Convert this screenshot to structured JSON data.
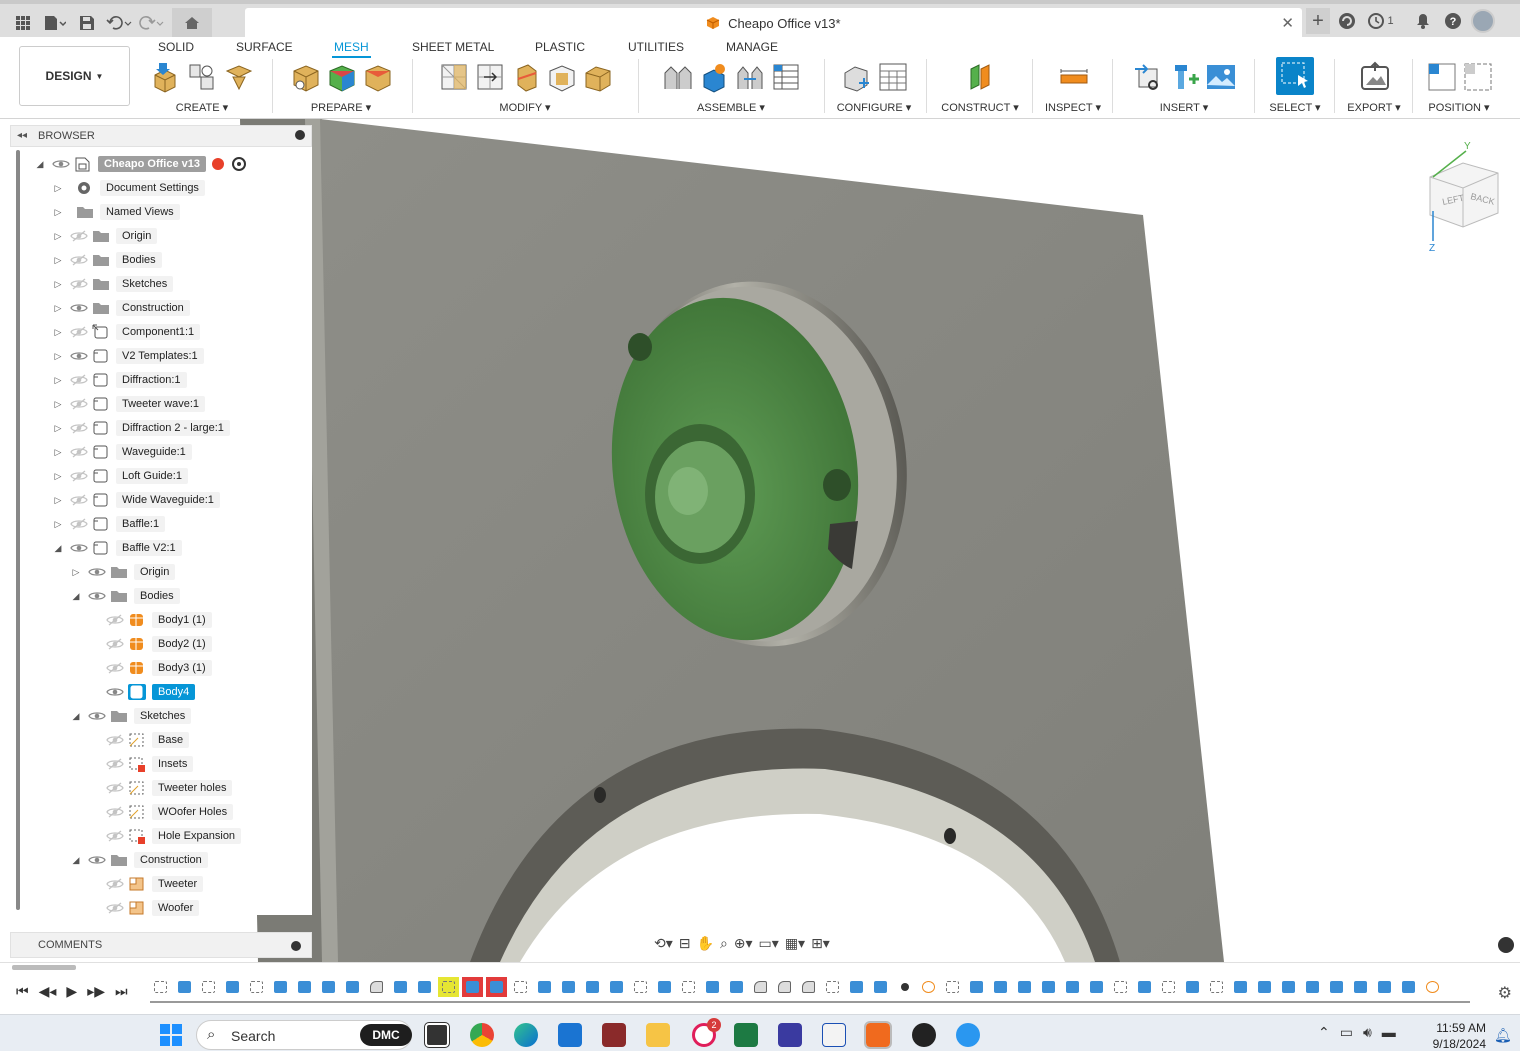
{
  "window": {
    "doc_title": "Cheapo Office v13*",
    "history_count": "1"
  },
  "ribbon": {
    "workspace": "DESIGN",
    "tabs": [
      "SOLID",
      "SURFACE",
      "MESH",
      "SHEET METAL",
      "PLASTIC",
      "UTILITIES",
      "MANAGE"
    ],
    "active_tab": "MESH",
    "groups": [
      "CREATE",
      "PREPARE",
      "MODIFY",
      "ASSEMBLE",
      "CONFIGURE",
      "CONSTRUCT",
      "INSPECT",
      "INSERT",
      "SELECT",
      "EXPORT",
      "POSITION"
    ]
  },
  "browser": {
    "title": "BROWSER",
    "comments": "COMMENTS",
    "items": [
      {
        "label": "Cheapo Office v13",
        "indent": 0,
        "expand": "open",
        "eye": "visible",
        "icon": "document"
      },
      {
        "label": "Document Settings",
        "indent": 1,
        "expand": "closed",
        "eye": "none",
        "icon": "gear"
      },
      {
        "label": "Named Views",
        "indent": 1,
        "expand": "closed",
        "eye": "none",
        "icon": "folder"
      },
      {
        "label": "Origin",
        "indent": 1,
        "expand": "closed",
        "eye": "hidden",
        "icon": "folder"
      },
      {
        "label": "Bodies",
        "indent": 1,
        "expand": "closed",
        "eye": "hidden",
        "icon": "folder"
      },
      {
        "label": "Sketches",
        "indent": 1,
        "expand": "closed",
        "eye": "hidden",
        "icon": "folder"
      },
      {
        "label": "Construction",
        "indent": 1,
        "expand": "closed",
        "eye": "visible",
        "icon": "folder"
      },
      {
        "label": "Component1:1",
        "indent": 1,
        "expand": "closed",
        "eye": "hidden",
        "icon": "component-link"
      },
      {
        "label": "V2 Templates:1",
        "indent": 1,
        "expand": "closed",
        "eye": "visible",
        "icon": "component"
      },
      {
        "label": "Diffraction:1",
        "indent": 1,
        "expand": "closed",
        "eye": "hidden",
        "icon": "component"
      },
      {
        "label": "Tweeter wave:1",
        "indent": 1,
        "expand": "closed",
        "eye": "hidden",
        "icon": "component"
      },
      {
        "label": "Diffraction 2 - large:1",
        "indent": 1,
        "expand": "closed",
        "eye": "hidden",
        "icon": "component"
      },
      {
        "label": "Waveguide:1",
        "indent": 1,
        "expand": "closed",
        "eye": "hidden",
        "icon": "component"
      },
      {
        "label": "Loft Guide:1",
        "indent": 1,
        "expand": "closed",
        "eye": "hidden",
        "icon": "component"
      },
      {
        "label": "Wide Waveguide:1",
        "indent": 1,
        "expand": "closed",
        "eye": "hidden",
        "icon": "component"
      },
      {
        "label": "Baffle:1",
        "indent": 1,
        "expand": "closed",
        "eye": "hidden",
        "icon": "component"
      },
      {
        "label": "Baffle V2:1",
        "indent": 1,
        "expand": "open",
        "eye": "visible",
        "icon": "component"
      },
      {
        "label": "Origin",
        "indent": 2,
        "expand": "closed",
        "eye": "visible",
        "icon": "folder"
      },
      {
        "label": "Bodies",
        "indent": 2,
        "expand": "open",
        "eye": "visible",
        "icon": "folder"
      },
      {
        "label": "Body1 (1)",
        "indent": 3,
        "expand": "none",
        "eye": "hidden",
        "icon": "mesh-body"
      },
      {
        "label": "Body2 (1)",
        "indent": 3,
        "expand": "none",
        "eye": "hidden",
        "icon": "mesh-body"
      },
      {
        "label": "Body3 (1)",
        "indent": 3,
        "expand": "none",
        "eye": "hidden",
        "icon": "mesh-body"
      },
      {
        "label": "Body4",
        "indent": 3,
        "expand": "none",
        "eye": "visible",
        "icon": "solid-body",
        "selected": true
      },
      {
        "label": "Sketches",
        "indent": 2,
        "expand": "open",
        "eye": "visible",
        "icon": "folder"
      },
      {
        "label": "Base",
        "indent": 3,
        "expand": "none",
        "eye": "hidden",
        "icon": "sketch"
      },
      {
        "label": "Insets",
        "indent": 3,
        "expand": "none",
        "eye": "hidden",
        "icon": "sketch-error"
      },
      {
        "label": "Tweeter holes",
        "indent": 3,
        "expand": "none",
        "eye": "hidden",
        "icon": "sketch"
      },
      {
        "label": "WOofer Holes",
        "indent": 3,
        "expand": "none",
        "eye": "hidden",
        "icon": "sketch"
      },
      {
        "label": "Hole Expansion",
        "indent": 3,
        "expand": "none",
        "eye": "hidden",
        "icon": "sketch-error"
      },
      {
        "label": "Construction",
        "indent": 2,
        "expand": "open",
        "eye": "visible",
        "icon": "folder"
      },
      {
        "label": "Tweeter",
        "indent": 3,
        "expand": "none",
        "eye": "hidden",
        "icon": "plane"
      },
      {
        "label": "Woofer",
        "indent": 3,
        "expand": "none",
        "eye": "hidden",
        "icon": "plane"
      }
    ]
  },
  "navcube": {
    "face_left": "LEFT",
    "face_right": "BACK",
    "axis_y": "Y",
    "axis_z": "Z"
  },
  "colors": {
    "accent": "#0696d7",
    "baffle": "#8a8a84",
    "mesh": "#4f8a47",
    "orange": "#f08c1e",
    "warning": "#e8402a"
  },
  "taskbar": {
    "search_placeholder": "Search",
    "dmc_label": "DMC",
    "time": "11:59 AM",
    "date": "9/18/2024",
    "slack_badge": "2"
  }
}
